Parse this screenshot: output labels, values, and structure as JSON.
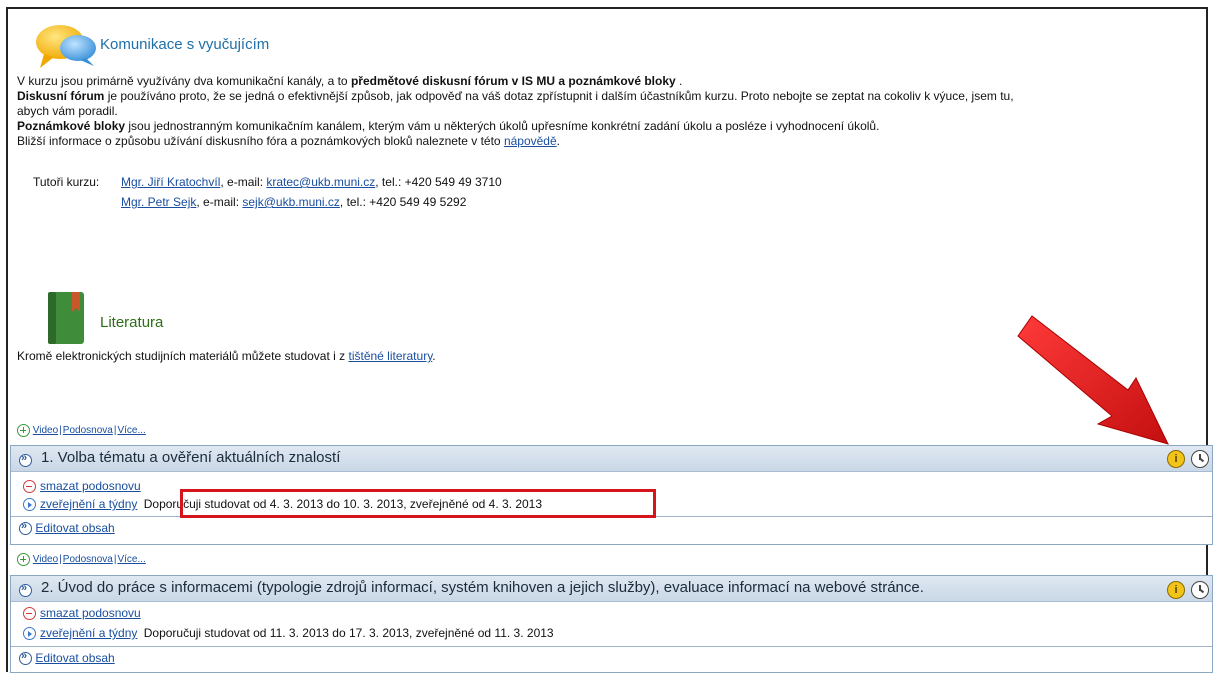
{
  "communication": {
    "title": "Komunikace s vyučujícím",
    "line1_pre": "V kurzu jsou primárně využívány dva komunikační kanály, a to ",
    "line1_bold": "předmětové diskusní fórum v IS MU a poznámkové bloky",
    "line1_post": " .",
    "line2_bold": "Diskusní fórum",
    "line2_text": " je používáno proto, že se jedná o efektivnější způsob, jak odpověď na váš dotaz zpřístupnit i dalším účastníkům kurzu. Proto nebojte se zeptat na cokoliv k výuce, jsem tu,",
    "line3_text": "abych vám poradil.",
    "line4_bold": "Poznámkové bloky",
    "line4_text": " jsou jednostranným komunikačním kanálem, kterým vám u některých úkolů upřesníme konkrétní zadání úkolu a posléze i vyhodnocení úkolů.",
    "line5_text": "Bližší informace o způsobu užívání diskusního fóra a poznámkových bloků naleznete v této ",
    "line5_link": "nápovědě",
    "line5_end": ".",
    "tutors_label": "Tutoři kurzu:",
    "tutors": [
      {
        "name": "Mgr. Jiří Kratochvíl",
        "email_label": ", e-mail: ",
        "email": "kratec@ukb.muni.cz",
        "tel": ", tel.: +420 549 49 3710"
      },
      {
        "name": "Mgr. Petr Sejk",
        "email_label": ", e-mail: ",
        "email": "sejk@ukb.muni.cz",
        "tel": ", tel.: +420 549 49 5292"
      }
    ]
  },
  "literature": {
    "title": "Literatura",
    "text": "Kromě elektronických studijních materiálů můžete studovat i z ",
    "link": "tištěné literatury",
    "end": "."
  },
  "add_links": {
    "video": "Video",
    "subtopic": "Podosnova",
    "more": "Více...",
    "sep": "|"
  },
  "modules": [
    {
      "title": "1. Volba tématu a ověření aktuálních znalostí",
      "delete_label": "smazat podosnovu",
      "publish_label": "zveřejnění a týdny",
      "publish_info": "Doporučuji studovat od 4. 3. 2013 do 10. 3. 2013, zveřejněné od 4. 3. 2013",
      "edit_label": "Editovat obsah",
      "info_icon": "i"
    },
    {
      "title": "2. Úvod do práce s informacemi (typologie zdrojů informací, systém knihoven a jejich služby), evaluace informací na webové stránce.",
      "delete_label": "smazat podosnovu",
      "publish_label": "zveřejnění a týdny",
      "publish_info": "Doporučuji studovat od 11. 3. 2013 do 17. 3. 2013, zveřejněné od 11. 3. 2013",
      "edit_label": "Editovat obsah",
      "info_icon": "i"
    }
  ],
  "colors": {
    "highlight": "#d4161c",
    "arrow": "#e01a1a",
    "module_header": "#cfdbe8"
  }
}
